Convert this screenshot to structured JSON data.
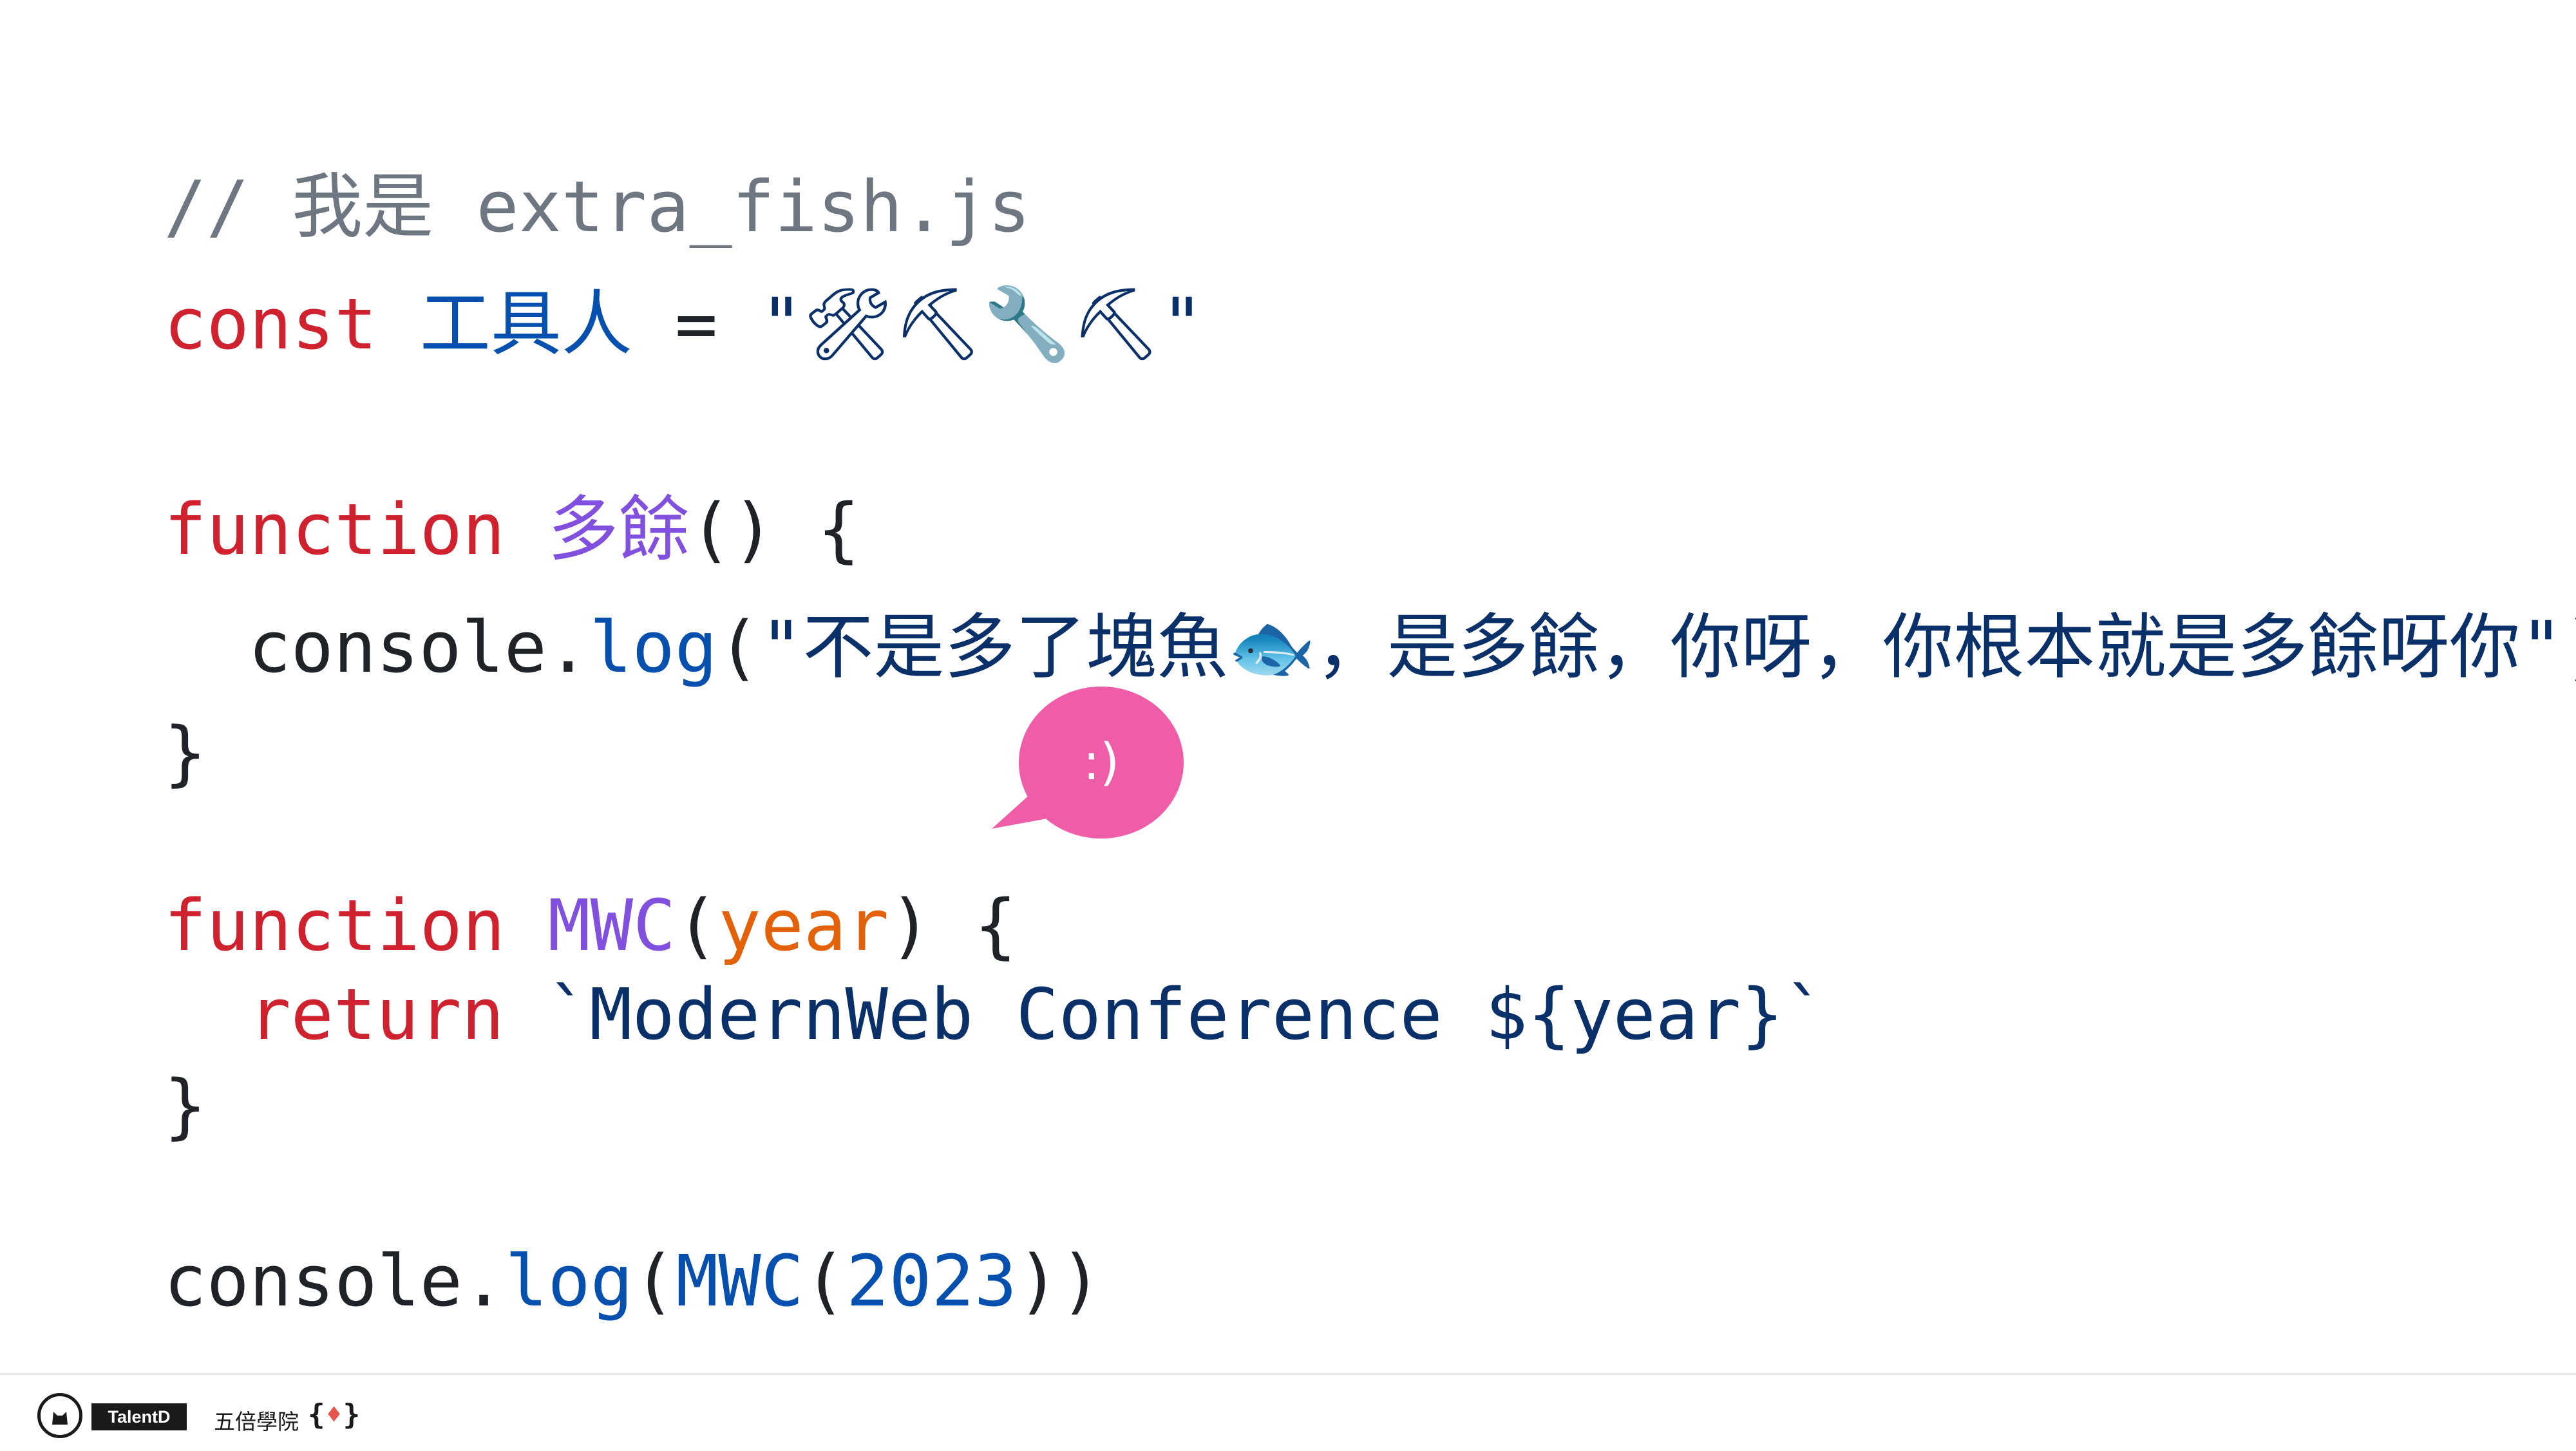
{
  "code": {
    "line1": {
      "comment": "// 我是 extra_fish.js"
    },
    "line2": {
      "keyword": "const ",
      "var_name": "工具人",
      "op": " = ",
      "string": "\"🛠⛏🔧⛏\""
    },
    "line3": {
      "keyword": "function ",
      "fn_name": "多餘",
      "rest": "() {"
    },
    "line4": {
      "obj": "console.",
      "method": "log",
      "open": "(",
      "string": "\"不是多了塊魚🐟，是多餘，你呀，你根本就是多餘呀你\"",
      "close": ")"
    },
    "line5": {
      "brace": "}"
    },
    "line6": {
      "keyword": "function ",
      "fn_name": "MWC",
      "open": "(",
      "param": "year",
      "close": ") {"
    },
    "line7": {
      "keyword": "return ",
      "template": "`ModernWeb Conference ${year}`"
    },
    "line8": {
      "brace": "}"
    },
    "line9": {
      "obj": "console.",
      "method": "log",
      "open1": "(",
      "fn_name": "MWC",
      "open2": "(",
      "number": "2023",
      "close": "))"
    }
  },
  "bubble": {
    "text": ":)"
  },
  "footer": {
    "badge": "TalentD",
    "school": "五倍學院",
    "brace_open": "{",
    "gem_icon": "♦",
    "brace_close": "}"
  },
  "colors": {
    "keyword": "#cf222e",
    "variable": "#0550ae",
    "function": "#8250df",
    "param": "#e36209",
    "string": "#0a3069",
    "comment": "#6e7781",
    "bubble": "#ef5da8"
  }
}
